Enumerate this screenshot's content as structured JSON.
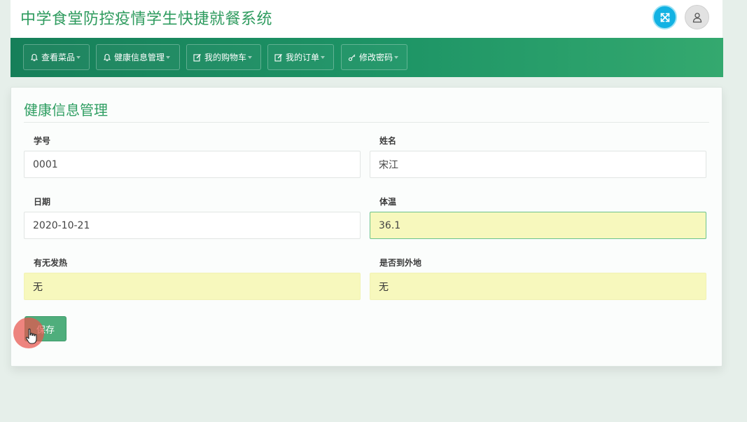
{
  "app": {
    "title": "中学食堂防控疫情学生快捷就餐系统"
  },
  "header": {
    "fullscreen_icon": "expand-arrows-icon",
    "user_icon": "user-icon",
    "accent_color": "#12b2e3"
  },
  "nav": {
    "items": [
      {
        "label": "查看菜品",
        "icon": "bell-icon"
      },
      {
        "label": "健康信息管理",
        "icon": "bell-icon"
      },
      {
        "label": "我的购物车",
        "icon": "edit-icon"
      },
      {
        "label": "我的订单",
        "icon": "edit-icon"
      },
      {
        "label": "修改密码",
        "icon": "key-icon"
      }
    ],
    "color_start": "#167f59",
    "color_end": "#34a96f"
  },
  "form": {
    "title": "健康信息管理",
    "fields": [
      {
        "label": "学号",
        "value": "0001"
      },
      {
        "label": "姓名",
        "value": "宋江"
      },
      {
        "label": "日期",
        "value": "2020-10-21"
      },
      {
        "label": "体温",
        "value": "36.1"
      },
      {
        "label": "有无发热",
        "value": "无"
      },
      {
        "label": "是否到外地",
        "value": "无"
      }
    ],
    "save_label": "保存"
  },
  "colors": {
    "brand_green": "#2e9b5e",
    "autofill_yellow": "#f7f8bd",
    "button_green": "#4fae7c"
  }
}
